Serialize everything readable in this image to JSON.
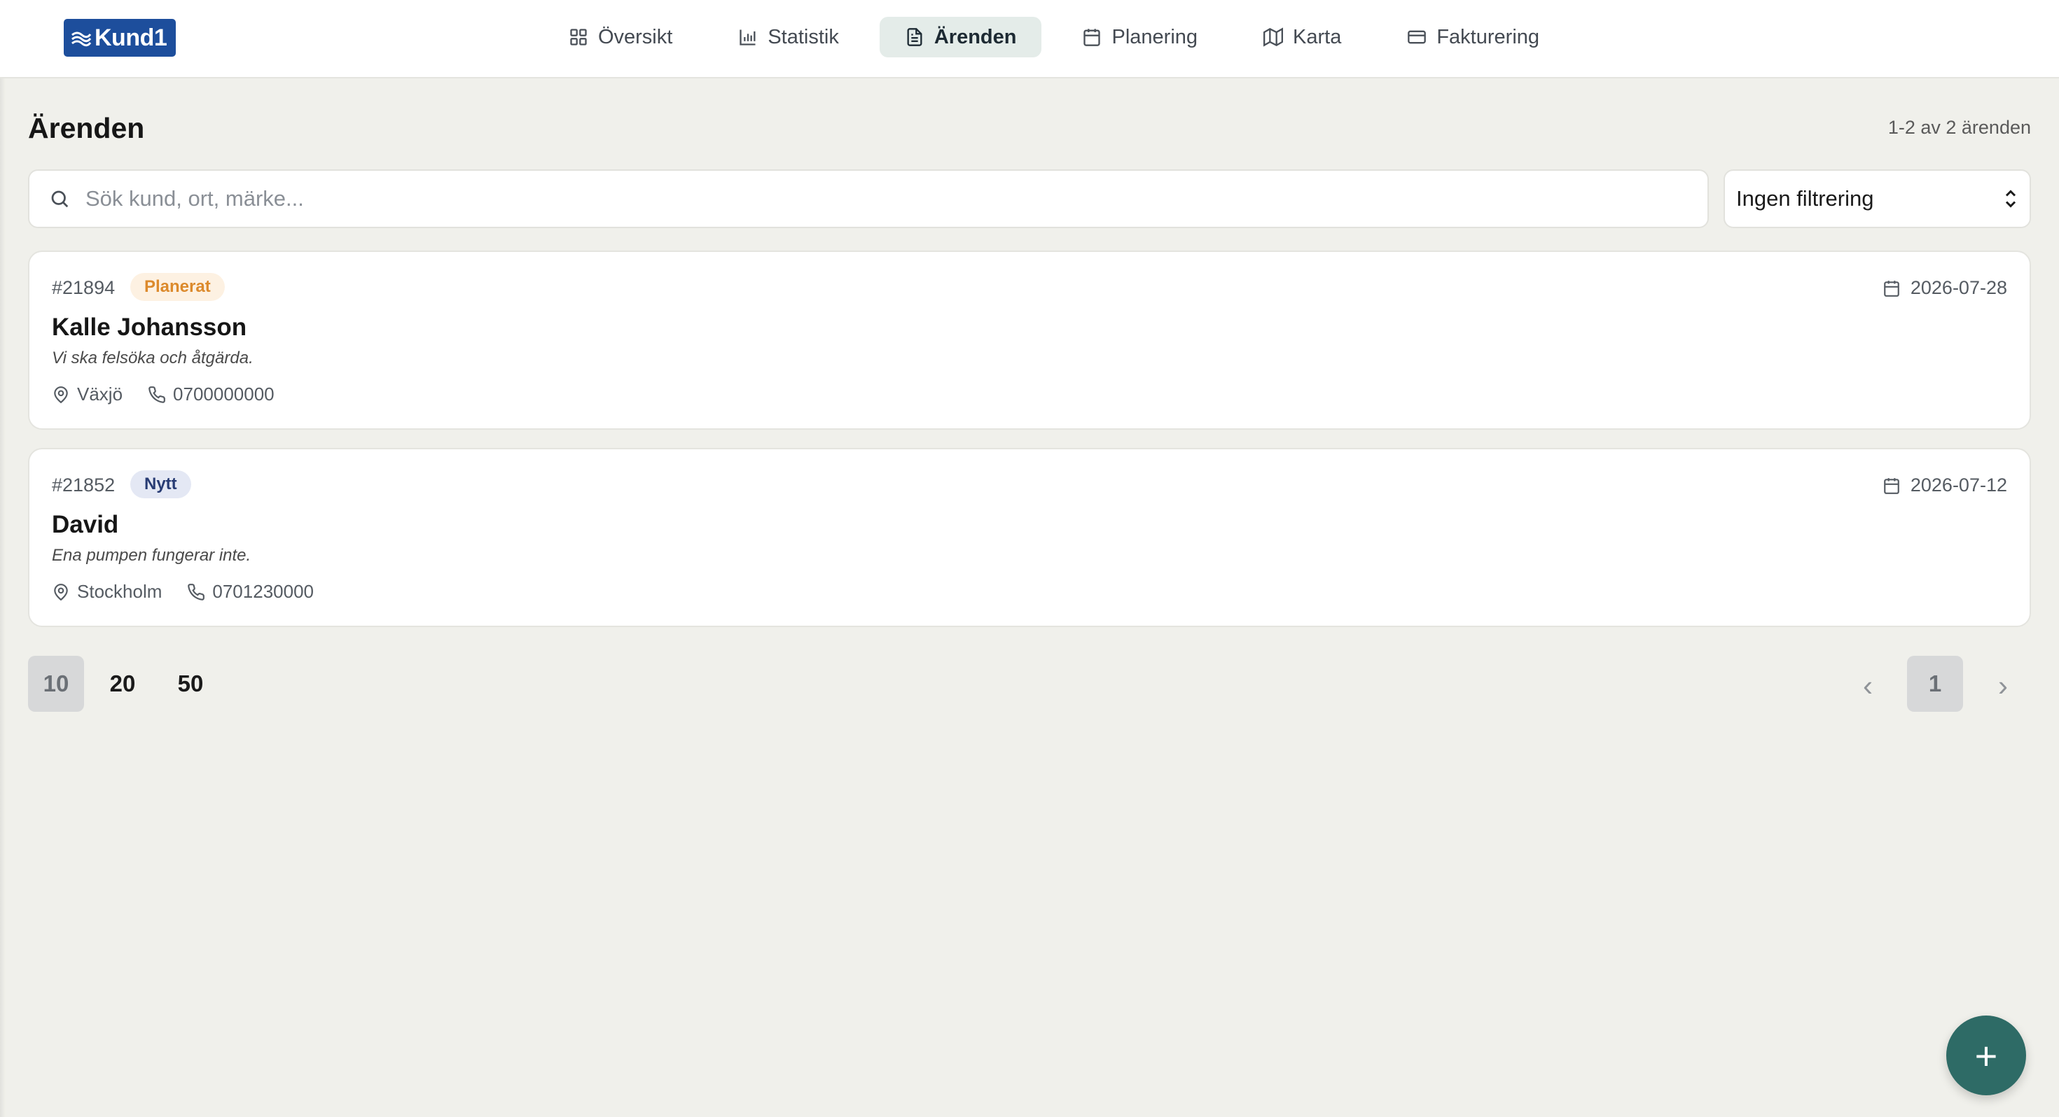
{
  "app": {
    "logo_text": "Kund1"
  },
  "nav": {
    "items": [
      {
        "label": "Översikt",
        "icon": "grid-icon"
      },
      {
        "label": "Statistik",
        "icon": "bar-chart-icon"
      },
      {
        "label": "Ärenden",
        "icon": "document-icon",
        "active": true
      },
      {
        "label": "Planering",
        "icon": "calendar-icon"
      },
      {
        "label": "Karta",
        "icon": "map-icon"
      },
      {
        "label": "Fakturering",
        "icon": "credit-card-icon"
      }
    ]
  },
  "page": {
    "title": "Ärenden",
    "result_count": "1-2 av 2 ärenden"
  },
  "search": {
    "placeholder": "Sök kund, ort, märke...",
    "value": ""
  },
  "filter": {
    "selected": "Ingen filtrering"
  },
  "cases": [
    {
      "number": "#21894",
      "status": "Planerat",
      "date": "2026-07-28",
      "name": "Kalle Johansson",
      "description": "Vi ska felsöka och åtgärda.",
      "city": "Växjö",
      "phone": "0700000000"
    },
    {
      "number": "#21852",
      "status": "Nytt",
      "date": "2026-07-12",
      "name": "David",
      "description": "Ena pumpen fungerar inte.",
      "city": "Stockholm",
      "phone": "0701230000"
    }
  ],
  "pagination": {
    "page_sizes": [
      "10",
      "20",
      "50"
    ],
    "selected_page_size": "10",
    "prev": "‹",
    "current_page": "1",
    "next": "›"
  },
  "fab": {
    "label": "+"
  },
  "colors": {
    "accent": "#2e6b66",
    "planned_badge": "#dc8a2c",
    "new_badge": "#283c74",
    "logo_bg": "#1d4e9c"
  }
}
